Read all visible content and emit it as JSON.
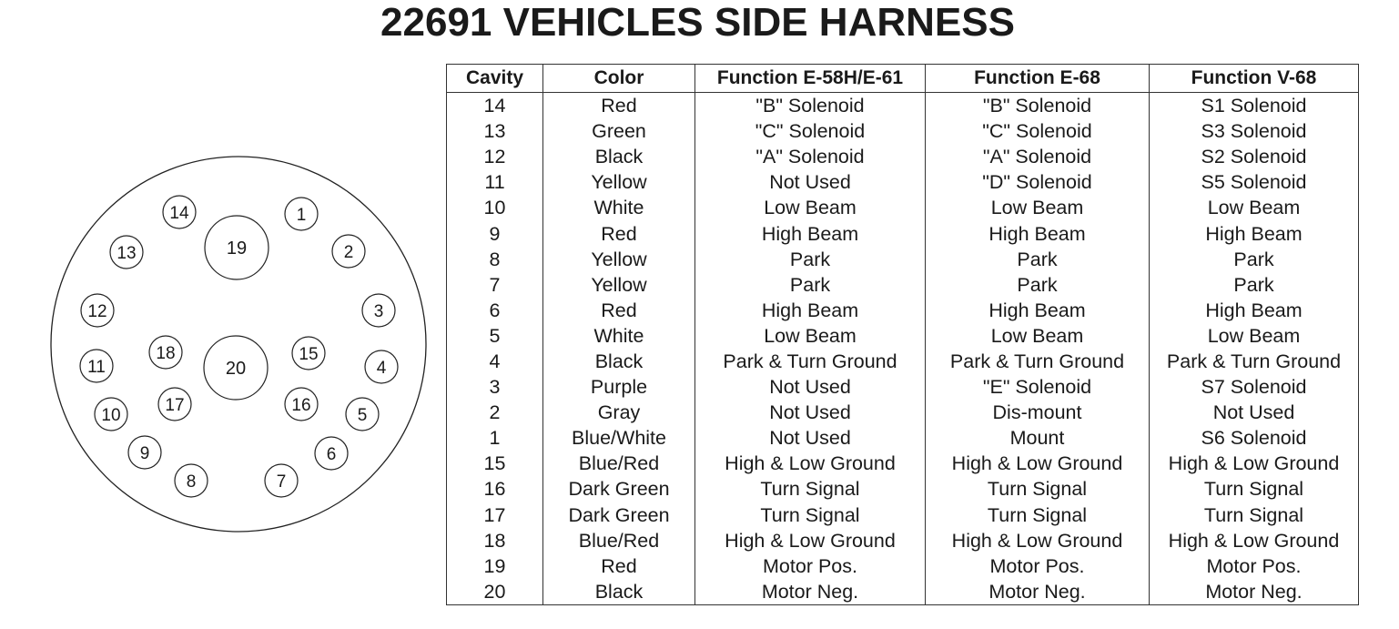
{
  "title": "22691 VEHICLES SIDE HARNESS",
  "connector": {
    "large_pins": [
      "19",
      "20"
    ],
    "outer_ring_pins": [
      "1",
      "2",
      "3",
      "4",
      "5",
      "6",
      "7",
      "8",
      "9",
      "10",
      "11",
      "12",
      "13",
      "14"
    ],
    "inner_ring_pins": [
      "15",
      "16",
      "17",
      "18"
    ]
  },
  "table": {
    "headers": [
      "Cavity",
      "Color",
      "Function  E-58H/E-61",
      "Function  E-68",
      "Function V-68"
    ],
    "rows": [
      [
        "14",
        "Red",
        "\"B\" Solenoid",
        "\"B\" Solenoid",
        "S1 Solenoid"
      ],
      [
        "13",
        "Green",
        "\"C\" Solenoid",
        "\"C\" Solenoid",
        "S3 Solenoid"
      ],
      [
        "12",
        "Black",
        "\"A\" Solenoid",
        "\"A\" Solenoid",
        "S2 Solenoid"
      ],
      [
        "11",
        "Yellow",
        "Not Used",
        "\"D\" Solenoid",
        "S5 Solenoid"
      ],
      [
        "10",
        "White",
        "Low Beam",
        "Low Beam",
        "Low Beam"
      ],
      [
        "9",
        "Red",
        "High Beam",
        "High Beam",
        "High Beam"
      ],
      [
        "8",
        "Yellow",
        "Park",
        "Park",
        "Park"
      ],
      [
        "7",
        "Yellow",
        "Park",
        "Park",
        "Park"
      ],
      [
        "6",
        "Red",
        "High Beam",
        "High Beam",
        "High Beam"
      ],
      [
        "5",
        "White",
        "Low Beam",
        "Low Beam",
        "Low Beam"
      ],
      [
        "4",
        "Black",
        "Park & Turn Ground",
        "Park & Turn Ground",
        "Park & Turn Ground"
      ],
      [
        "3",
        "Purple",
        "Not Used",
        "\"E\" Solenoid",
        "S7 Solenoid"
      ],
      [
        "2",
        "Gray",
        "Not Used",
        "Dis-mount",
        "Not Used"
      ],
      [
        "1",
        "Blue/White",
        "Not Used",
        "Mount",
        "S6 Solenoid"
      ],
      [
        "15",
        "Blue/Red",
        "High & Low Ground",
        "High & Low Ground",
        "High & Low Ground"
      ],
      [
        "16",
        "Dark Green",
        "Turn  Signal",
        "Turn  Signal",
        "Turn  Signal"
      ],
      [
        "17",
        "Dark Green",
        "Turn  Signal",
        "Turn  Signal",
        "Turn  Signal"
      ],
      [
        "18",
        "Blue/Red",
        "High & Low Ground",
        "High & Low Ground",
        "High & Low Ground"
      ],
      [
        "19",
        "Red",
        "Motor Pos.",
        "Motor Pos.",
        "Motor Pos."
      ],
      [
        "20",
        "Black",
        "Motor Neg.",
        "Motor Neg.",
        "Motor Neg."
      ]
    ]
  }
}
